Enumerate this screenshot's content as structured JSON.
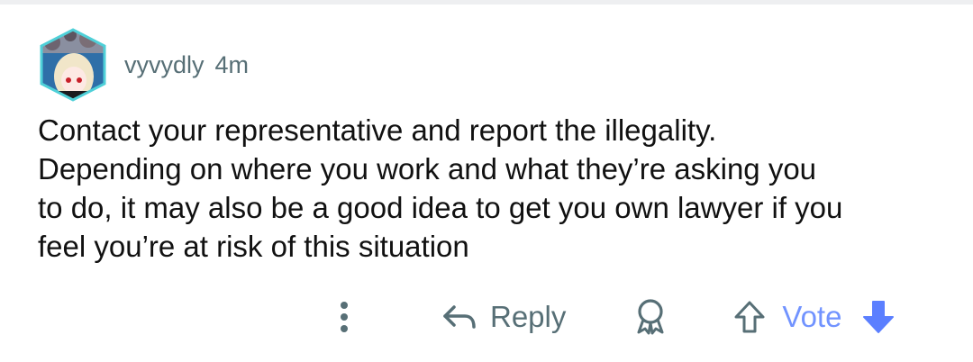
{
  "comment": {
    "username": "vyvydly",
    "timestamp": "4m",
    "body": "Contact your representative and report the illegality.\nDepending on where you work and what they’re asking you\nto do, it may also be a good idea to get you own lawyer if you\nfeel you’re at risk of this situation",
    "avatar_icon": "avatar-icon"
  },
  "actions": {
    "more_icon": "more-vertical-icon",
    "reply_icon": "reply-arrow-icon",
    "reply_label": "Reply",
    "award_icon": "award-icon",
    "upvote_icon": "upvote-arrow-icon",
    "vote_label": "Vote",
    "downvote_icon": "downvote-arrow-icon"
  },
  "colors": {
    "meta_text": "#576f76",
    "vote_active": "#7193ff",
    "body_text": "#111111"
  }
}
